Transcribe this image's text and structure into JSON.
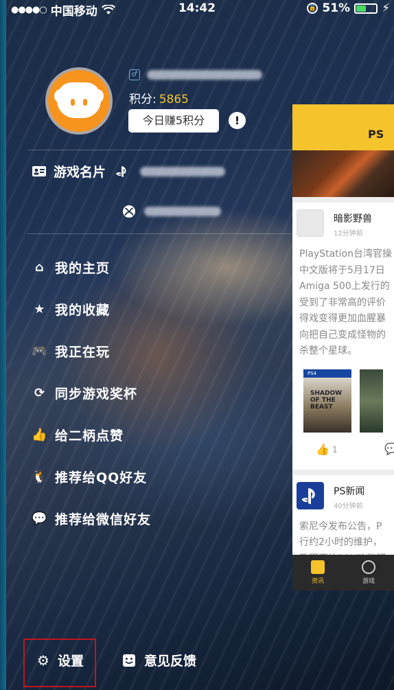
{
  "status_bar": {
    "signal_dots": "●●●●○",
    "carrier": "中国移动",
    "wifi_icon": "wifi-icon",
    "time": "14:42",
    "battery": "51%",
    "battery_level": 0.51,
    "battery_color": "#4cd964"
  },
  "profile": {
    "points_label": "积分:",
    "points_value": "5865",
    "earn_button": "今日赚5积分",
    "alert_icon": "!"
  },
  "game_card": {
    "label": "游戏名片"
  },
  "menu": [
    {
      "icon": "home-icon",
      "glyph": "⌂",
      "label": "我的主页"
    },
    {
      "icon": "star-icon",
      "glyph": "★",
      "label": "我的收藏"
    },
    {
      "icon": "gamepad-icon",
      "glyph": "🎮",
      "label": "我正在玩"
    },
    {
      "icon": "sync-icon",
      "glyph": "⟳",
      "label": "同步游戏奖杯"
    },
    {
      "icon": "thumbs-up-icon",
      "glyph": "👍",
      "label": "给二柄点赞"
    },
    {
      "icon": "qq-icon",
      "glyph": "🐧",
      "label": "推荐给QQ好友"
    },
    {
      "icon": "wechat-icon",
      "glyph": "💬",
      "label": "推荐给微信好友"
    }
  ],
  "bottom": {
    "settings": "设置",
    "feedback": "意见反馈"
  },
  "panel": {
    "header": "PS",
    "posts": [
      {
        "name": "暗影野兽",
        "time": "12分钟前",
        "lines": [
          "PlayStation台湾官操",
          "中文版将于5月17日",
          "Amiga 500上发行的",
          "受到了非常高的评价",
          "得戏变得更加血腥暴",
          "向把自己变成怪物的",
          "杀整个星球。"
        ],
        "cover_badge": "PS4",
        "cover_title": "SHADOW OF THE BEAST",
        "likes": "1"
      },
      {
        "name": "PS新闻",
        "time": "40分钟前",
        "lines": [
          "索尼今发布公告，P",
          "行约2小时的维护，",
          "及网页的PSN功能都"
        ]
      }
    ],
    "tabs": [
      "资讯",
      "游戏"
    ]
  },
  "colors": {
    "accent_yellow": "#f5c32c",
    "avatar_orange": "#f7941e",
    "highlight_red": "#c0151c"
  }
}
